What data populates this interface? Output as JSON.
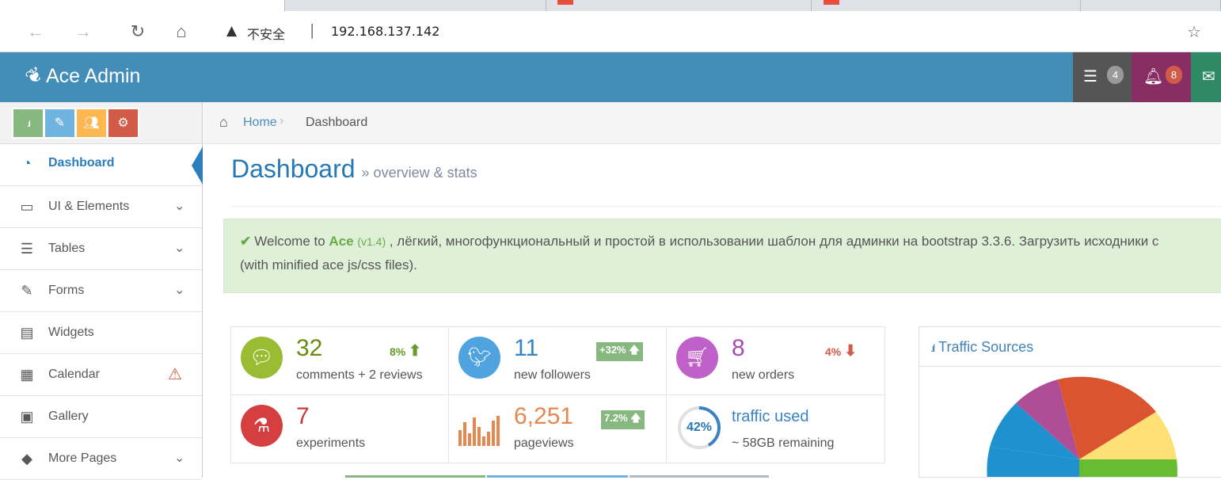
{
  "browser": {
    "address_insecure_label": "不安全",
    "address_separator": "|",
    "url": "192.168.137.142",
    "icons": [
      "back-arrow-icon",
      "forward-arrow-icon",
      "reload-icon",
      "home-icon",
      "warning-icon",
      "star-add-icon"
    ]
  },
  "navbar": {
    "brand": "Ace Admin",
    "tasks_badge": "4",
    "notifications_badge": "8",
    "colors": {
      "bar": "#438eb9",
      "tasks_box": "#555555",
      "notifications_box": "#892e65",
      "messages_box": "#2e8965"
    }
  },
  "shortcuts": {
    "colors": [
      "#87b87f",
      "#6fb3e0",
      "#ffb752",
      "#d15b47"
    ],
    "icons": [
      "signal-icon",
      "pencil-icon",
      "users-icon",
      "cogs-icon"
    ]
  },
  "sidebar": {
    "items": [
      {
        "label": "Dashboard",
        "icon": "tachometer-icon",
        "active": true
      },
      {
        "label": "UI & Elements",
        "icon": "desktop-icon",
        "has_submenu": true
      },
      {
        "label": "Tables",
        "icon": "list-icon",
        "has_submenu": true
      },
      {
        "label": "Forms",
        "icon": "pencil-square-icon",
        "has_submenu": true
      },
      {
        "label": "Widgets",
        "icon": "list-alt-icon"
      },
      {
        "label": "Calendar",
        "icon": "calendar-icon",
        "badge_icon": "warning-icon"
      },
      {
        "label": "Gallery",
        "icon": "picture-icon"
      },
      {
        "label": "More Pages",
        "icon": "tag-icon",
        "has_submenu": true
      }
    ]
  },
  "breadcrumbs": {
    "home": "Home",
    "current": "Dashboard"
  },
  "page": {
    "title": "Dashboard",
    "subtitle": "» overview & stats"
  },
  "alert": {
    "welcome": "Welcome to ",
    "name": "Ace",
    "version": "(v1.4)",
    "text_line1": " , лёгкий, многофункциональный и простой в использовании шаблон для админки на bootstrap 3.3.6. Загрузить исходники с",
    "text_line2": "(with minified ace js/css files)."
  },
  "stats": {
    "comments": {
      "value": "32",
      "label": "comments + 2 reviews",
      "trend": "8%",
      "color": "#9abc32"
    },
    "followers": {
      "value": "11",
      "label": "new followers",
      "trend": "+32%",
      "color": "#4fa3de"
    },
    "orders": {
      "value": "8",
      "label": "new orders",
      "trend": "4%",
      "color": "#c060c9"
    },
    "experiments": {
      "value": "7",
      "label": "experiments",
      "color": "#d53f40"
    },
    "pageviews": {
      "value": "6,251",
      "label": "pageviews",
      "trend": "7.2%",
      "color": "#e8864f"
    },
    "traffic": {
      "percent": "42%",
      "fraction": 0.42,
      "title": "traffic used",
      "label": "~ 58GB remaining"
    }
  },
  "traffic_sources": {
    "title": "Traffic Sources",
    "slice_colors": [
      "#2091cf",
      "#af4e96",
      "#da5430",
      "#fee074",
      "#68bc31"
    ]
  }
}
